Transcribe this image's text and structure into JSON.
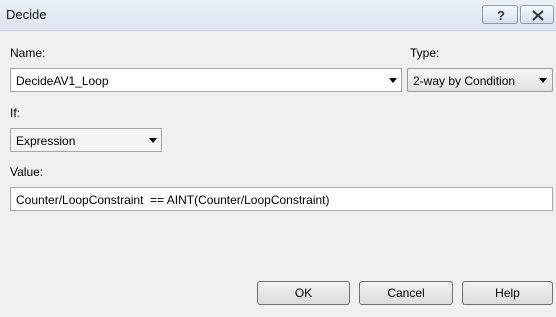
{
  "window": {
    "title": "Decide"
  },
  "titlebar": {
    "help_icon": "question-mark-icon",
    "close_icon": "close-x-icon"
  },
  "form": {
    "name_label": "Name:",
    "name_value": "DecideAV1_Loop",
    "type_label": "Type:",
    "type_value": "2-way by Condition",
    "if_label": "If:",
    "if_value": "Expression",
    "value_label": "Value:",
    "value_text": "Counter/LoopConstraint  == AINT(Counter/LoopConstraint)"
  },
  "buttons": {
    "ok": "OK",
    "cancel": "Cancel",
    "help": "Help"
  }
}
